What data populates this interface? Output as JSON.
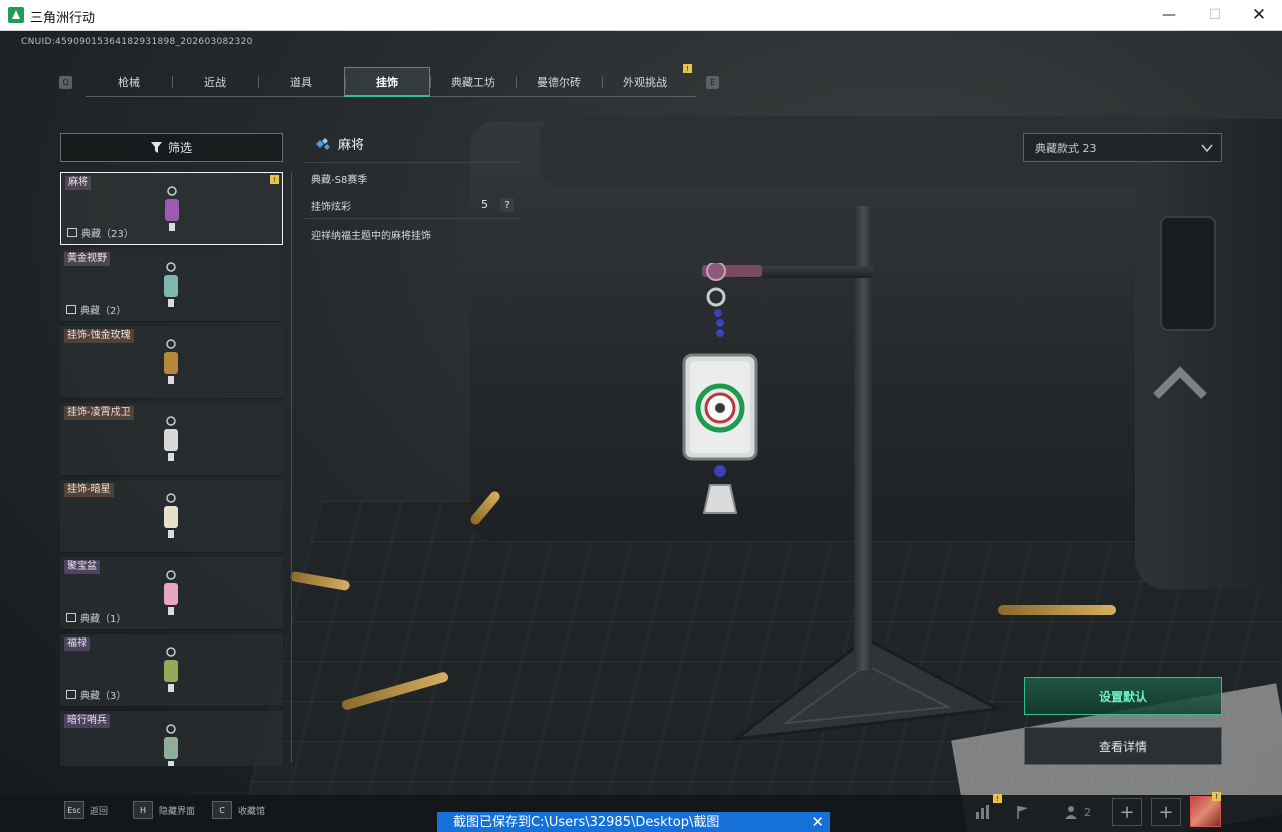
{
  "window": {
    "title": "三角洲行动",
    "minimize": "—",
    "maximize": "☐",
    "close": "✕"
  },
  "cn_uid": "CNUID:4590901536418293189​8_202603082320",
  "tabs": [
    {
      "label": "枪械",
      "active": false
    },
    {
      "label": "近战",
      "active": false
    },
    {
      "label": "道具",
      "active": false
    },
    {
      "label": "挂饰",
      "active": true
    },
    {
      "label": "典藏工坊",
      "active": false
    },
    {
      "label": "曼德尔砖",
      "active": false
    },
    {
      "label": "外观挑战",
      "active": false
    }
  ],
  "tab_keys": {
    "left": "Q",
    "right": "E"
  },
  "notif_mark": "!",
  "filter": {
    "label": "筛选"
  },
  "items": [
    {
      "name": "麻将",
      "count": "典藏（23）",
      "selected": true,
      "flag": true,
      "thumb_color": "#9b5bb0"
    },
    {
      "name": "黄金视野",
      "count": "典藏（2）",
      "selected": false,
      "flag": false,
      "thumb_color": "#7fb7b0"
    },
    {
      "name": "挂饰-蚀金玫瑰",
      "count": "",
      "selected": false,
      "flag": false,
      "thumb_color": "#b48a3a"
    },
    {
      "name": "挂饰-凌霄戍卫",
      "count": "",
      "selected": false,
      "flag": false,
      "thumb_color": "#d8d8d8"
    },
    {
      "name": "挂饰-暗星",
      "count": "",
      "selected": false,
      "flag": false,
      "thumb_color": "#e8e0c8"
    },
    {
      "name": "聚宝盆",
      "count": "典藏（1）",
      "selected": false,
      "flag": false,
      "thumb_color": "#e8a6c0"
    },
    {
      "name": "福禄",
      "count": "典藏（3）",
      "selected": false,
      "flag": false,
      "thumb_color": "#9aa65a"
    },
    {
      "name": "暗行哨兵",
      "count": "",
      "selected": false,
      "flag": false,
      "thumb_color": "#8fae9a"
    }
  ],
  "detail": {
    "title": "麻将",
    "season": "典藏-S8赛季",
    "flair_label": "挂饰炫彩",
    "flair_value": "5",
    "help": "?",
    "description": "迎祥纳福主题中的麻将挂饰"
  },
  "style_select": {
    "value": "典藏款式 23"
  },
  "buttons": {
    "set_default": "设置默认",
    "view_details": "查看详情"
  },
  "bottom_hints": [
    {
      "key": "Esc",
      "label": "返回"
    },
    {
      "key": "H",
      "label": "隐藏界面"
    },
    {
      "key": "C",
      "label": "收藏馆"
    }
  ],
  "team_count": "2",
  "toast": {
    "text": "截图已保存到C:\\Users\\32985\\Desktop\\截图",
    "close": "✕"
  },
  "colors": {
    "accent": "#2fc08f",
    "toast": "#1570d8",
    "notice": "#e6c44a"
  }
}
